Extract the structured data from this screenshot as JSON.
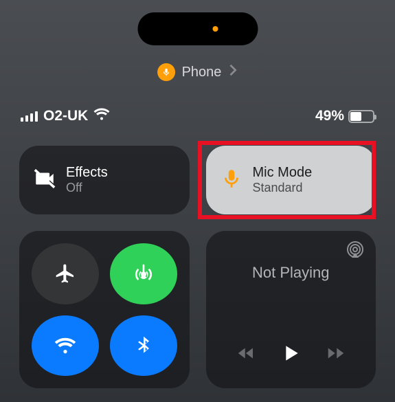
{
  "dynamic_island": {
    "indicator_color": "#ff9f0a"
  },
  "app_indicator": {
    "app_name": "Phone"
  },
  "status_bar": {
    "carrier": "O2-UK",
    "battery_pct": "49%"
  },
  "tiles": {
    "effects": {
      "title": "Effects",
      "subtitle": "Off"
    },
    "mic_mode": {
      "title": "Mic Mode",
      "subtitle": "Standard",
      "highlighted": true
    },
    "connectivity": {
      "airplane": false,
      "cellular": true,
      "wifi": true,
      "bluetooth": true
    },
    "media": {
      "now_playing": "Not Playing"
    }
  },
  "icons": {
    "mic": "mic-icon",
    "video_off": "video-off-icon",
    "airplane": "airplane-icon",
    "antenna": "cellular-antenna-icon",
    "wifi": "wifi-icon",
    "bluetooth": "bluetooth-icon",
    "airplay": "airplay-icon",
    "rewind": "rewind-icon",
    "play": "play-icon",
    "forward": "forward-icon",
    "chevron": "chevron-right-icon"
  },
  "colors": {
    "accent_orange": "#ff9f0a",
    "highlight_red": "#e81123",
    "toggle_green": "#30d158",
    "toggle_blue": "#0a7aff"
  }
}
